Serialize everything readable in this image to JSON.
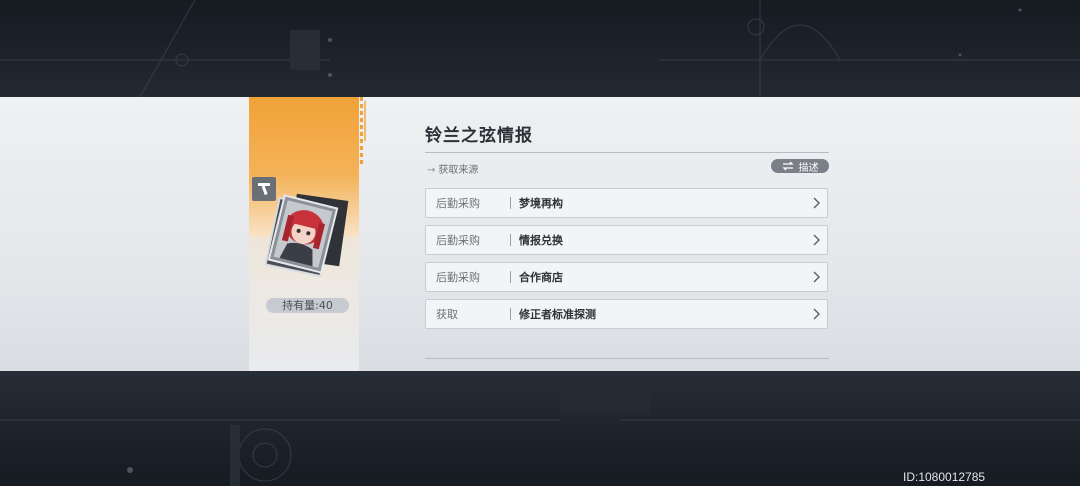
{
  "item": {
    "title": "铃兰之弦情报",
    "hold_count": "持有量:40",
    "type_icon": "tool-icon",
    "portrait": "character-portrait-card"
  },
  "source": {
    "label": "获取来源",
    "describe_button": "描述",
    "swap_icon": "swap-arrows-icon"
  },
  "sources": [
    {
      "category": "后勤采购",
      "name": "梦境再构"
    },
    {
      "category": "后勤采购",
      "name": "情报兑换"
    },
    {
      "category": "后勤采购",
      "name": "合作商店"
    },
    {
      "category": "获取",
      "name": "修正者标准探测"
    }
  ],
  "uid": "ID:1080012785",
  "colors": {
    "accent_orange": "#f0a238",
    "panel_bg": "#e8ebee",
    "background": "#1b2129"
  }
}
